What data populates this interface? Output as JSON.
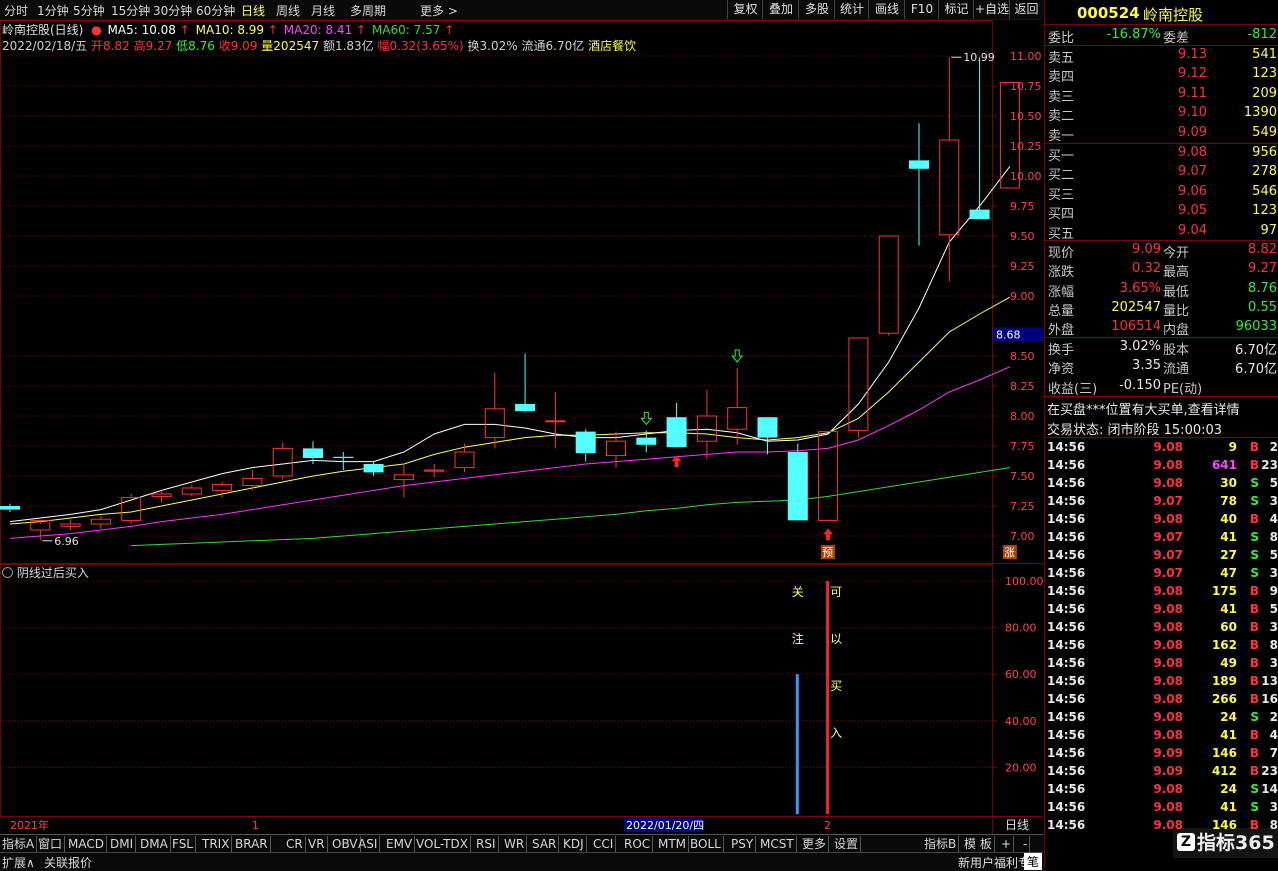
{
  "toolbar": {
    "periods": [
      "分时",
      "1分钟",
      "5分钟",
      "15分钟",
      "30分钟",
      "60分钟",
      "日线",
      "周线",
      "月线",
      "多周期",
      "更多 >"
    ],
    "active": "日线",
    "right_buttons": [
      "复权",
      "叠加",
      "多股",
      "统计",
      "画线",
      "F10",
      "标记",
      "+自选",
      "返回"
    ]
  },
  "chart_header": {
    "title": "岭南控股(日线)",
    "ma5": "MA5: 10.08",
    "ma10": "MA10: 8.99",
    "ma20": "MA20: 8.41",
    "ma60": "MA60: 7.57",
    "info_date": "2022/02/18/五",
    "open": "开8.82",
    "high": "高9.27",
    "low": "低8.76",
    "close": "收9.09",
    "volume": "量202547",
    "amount": "额1.83亿",
    "change": "幅0.32(3.65%)",
    "turnover": "换3.02%",
    "float_cap": "流通6.70亿",
    "industry": "酒店餐饮"
  },
  "colors": {
    "up": "#ff3333",
    "down": "#54ffff",
    "ma5": "#ffffff",
    "ma10": "#ffff55",
    "ma20": "#ff33ff",
    "ma60": "#33dd33",
    "grid": "#7a0000"
  },
  "chart_data": {
    "type": "candlestick",
    "y_ticks": [
      "11.00",
      "10.75",
      "10.50",
      "10.25",
      "10.00",
      "9.75",
      "9.50",
      "9.25",
      "9.00",
      "8.68",
      "8.50",
      "8.25",
      "8.00",
      "7.75",
      "7.50",
      "7.25",
      "7.00"
    ],
    "current_price_label": "8.68",
    "high_label": "10.99",
    "low_label": "6.96",
    "ylim": [
      6.88,
      11.18
    ],
    "candles": [
      [
        7.25,
        7.27,
        7.2,
        7.22
      ],
      [
        7.05,
        7.1,
        6.96,
        7.13
      ],
      [
        7.08,
        7.14,
        7.05,
        7.1
      ],
      [
        7.1,
        7.17,
        7.06,
        7.14
      ],
      [
        7.13,
        7.35,
        7.1,
        7.32
      ],
      [
        7.33,
        7.38,
        7.28,
        7.35
      ],
      [
        7.35,
        7.43,
        7.33,
        7.4
      ],
      [
        7.38,
        7.45,
        7.32,
        7.43
      ],
      [
        7.42,
        7.55,
        7.38,
        7.48
      ],
      [
        7.5,
        7.78,
        7.47,
        7.73
      ],
      [
        7.73,
        7.79,
        7.6,
        7.65
      ],
      [
        7.66,
        7.7,
        7.55,
        7.65
      ],
      [
        7.6,
        7.62,
        7.5,
        7.53
      ],
      [
        7.47,
        7.6,
        7.32,
        7.51
      ],
      [
        7.54,
        7.6,
        7.49,
        7.55
      ],
      [
        7.57,
        7.77,
        7.53,
        7.7
      ],
      [
        7.82,
        8.36,
        7.73,
        8.06
      ],
      [
        8.1,
        8.52,
        8.03,
        8.04
      ],
      [
        7.96,
        8.2,
        7.73,
        7.96
      ],
      [
        7.87,
        7.89,
        7.62,
        7.69
      ],
      [
        7.67,
        7.87,
        7.57,
        7.79
      ],
      [
        7.82,
        7.88,
        7.7,
        7.76
      ],
      [
        7.99,
        8.11,
        7.74,
        7.74
      ],
      [
        7.79,
        8.22,
        7.64,
        8.0
      ],
      [
        7.89,
        8.4,
        7.76,
        8.07
      ],
      [
        7.99,
        7.99,
        7.68,
        7.82
      ],
      [
        7.7,
        7.77,
        7.13,
        7.13
      ],
      [
        7.13,
        7.87,
        7.13,
        7.87
      ],
      [
        7.88,
        8.65,
        7.82,
        8.65
      ],
      [
        8.69,
        9.5,
        8.67,
        9.5
      ],
      [
        10.13,
        10.44,
        9.42,
        10.06
      ],
      [
        9.51,
        10.99,
        9.12,
        10.3
      ],
      [
        9.72,
        10.99,
        9.7,
        9.64
      ],
      [
        9.9,
        10.78,
        9.9,
        10.78
      ]
    ],
    "ma5": [
      7.12,
      7.15,
      7.18,
      7.22,
      7.3,
      7.38,
      7.45,
      7.52,
      7.57,
      7.6,
      7.63,
      7.62,
      7.62,
      7.7,
      7.85,
      7.93,
      7.93,
      7.9,
      7.85,
      7.82,
      7.82,
      7.85,
      7.88,
      7.89,
      7.86,
      7.79,
      7.8,
      7.85,
      8.1,
      8.45,
      8.9,
      9.45,
      9.75,
      10.08
    ],
    "ma10": [
      7.1,
      7.12,
      7.15,
      7.18,
      7.2,
      7.25,
      7.3,
      7.35,
      7.4,
      7.45,
      7.5,
      7.54,
      7.57,
      7.6,
      7.68,
      7.74,
      7.78,
      7.82,
      7.84,
      7.84,
      7.85,
      7.86,
      7.86,
      7.85,
      7.82,
      7.8,
      7.82,
      7.86,
      7.98,
      8.2,
      8.45,
      8.7,
      8.85,
      8.99
    ],
    "ma20": [
      6.98,
      7.0,
      7.02,
      7.05,
      7.08,
      7.12,
      7.15,
      7.18,
      7.22,
      7.26,
      7.3,
      7.34,
      7.38,
      7.42,
      7.45,
      7.48,
      7.51,
      7.54,
      7.57,
      7.6,
      7.62,
      7.64,
      7.66,
      7.68,
      7.7,
      7.7,
      7.71,
      7.73,
      7.8,
      7.92,
      8.05,
      8.2,
      8.3,
      8.41
    ],
    "ma60": [
      6.88,
      6.89,
      6.9,
      6.91,
      6.92,
      6.93,
      6.94,
      6.95,
      6.96,
      6.97,
      6.98,
      7.0,
      7.02,
      7.04,
      7.06,
      7.08,
      7.1,
      7.12,
      7.14,
      7.16,
      7.18,
      7.21,
      7.23,
      7.26,
      7.28,
      7.29,
      7.3,
      7.33,
      7.37,
      7.41,
      7.45,
      7.49,
      7.53,
      7.57
    ],
    "red_up_arrows_at": [
      22,
      27
    ],
    "green_down_arrows_at": [
      21,
      24
    ],
    "labels_at": [
      {
        "i": 27,
        "text": "预"
      },
      {
        "i": 33,
        "text": "涨"
      }
    ]
  },
  "indicator": {
    "title": "阴线过后买入",
    "y_ticks": [
      "100.00",
      "80.00",
      "60.00",
      "40.00",
      "20.00"
    ],
    "ylim": [
      0,
      105
    ],
    "cyan_bar": {
      "i": 26,
      "value": 60,
      "label_chars": [
        "关",
        "注"
      ]
    },
    "red_bar": {
      "i": 27,
      "value": 100,
      "label_chars": [
        "可",
        "以",
        "买",
        "入"
      ]
    }
  },
  "x_axis": {
    "labels": [
      "2021年",
      "1",
      "2022/01/20/四",
      "2"
    ],
    "period_label": "日线"
  },
  "bottom_tabs": [
    "指标A",
    "窗口",
    "MACD",
    "DMI",
    "DMA",
    "FSL",
    "TRIX",
    "BRAR",
    "CR",
    "VR",
    "OBV",
    "ASI",
    "EMV",
    "VOL-TDX",
    "RSI",
    "WR",
    "SAR",
    "KDJ",
    "CCI",
    "ROC",
    "MTM",
    "BOLL",
    "PSY",
    "MCST",
    "更多",
    "设置"
  ],
  "bottom_right_tabs": [
    "指标B",
    "模 板",
    "+",
    "-"
  ],
  "bottom_bar": {
    "left": [
      "扩展∧",
      "关联报价"
    ],
    "right": "新用户福利专享",
    "input": "笔"
  },
  "quote": {
    "code": "000524",
    "name": "岭南控股",
    "weibi_label": "委比",
    "weibi": "-16.87%",
    "weicha_label": "委差",
    "weicha": "-812",
    "sells": [
      {
        "label": "卖五",
        "price": "9.13",
        "vol": "541"
      },
      {
        "label": "卖四",
        "price": "9.12",
        "vol": "123"
      },
      {
        "label": "卖三",
        "price": "9.11",
        "vol": "209"
      },
      {
        "label": "卖二",
        "price": "9.10",
        "vol": "1390"
      },
      {
        "label": "卖一",
        "price": "9.09",
        "vol": "549"
      }
    ],
    "buys": [
      {
        "label": "买一",
        "price": "9.08",
        "vol": "956"
      },
      {
        "label": "买二",
        "price": "9.07",
        "vol": "278"
      },
      {
        "label": "买三",
        "price": "9.06",
        "vol": "546"
      },
      {
        "label": "买四",
        "price": "9.05",
        "vol": "123"
      },
      {
        "label": "买五",
        "price": "9.04",
        "vol": "97"
      }
    ],
    "stats": [
      {
        "l1": "现价",
        "v1": "9.09",
        "c1": "red",
        "l2": "今开",
        "v2": "8.82",
        "c2": "red"
      },
      {
        "l1": "涨跌",
        "v1": "0.32",
        "c1": "red",
        "l2": "最高",
        "v2": "9.27",
        "c2": "red"
      },
      {
        "l1": "涨幅",
        "v1": "3.65%",
        "c1": "red",
        "l2": "最低",
        "v2": "8.76",
        "c2": "green"
      },
      {
        "l1": "总量",
        "v1": "202547",
        "c1": "yellow",
        "l2": "量比",
        "v2": "0.55",
        "c2": "green"
      },
      {
        "l1": "外盘",
        "v1": "106514",
        "c1": "red",
        "l2": "内盘",
        "v2": "96033",
        "c2": "green"
      }
    ],
    "stats2": [
      {
        "l1": "换手",
        "v1": "3.02%",
        "l2": "股本",
        "v2": "6.70亿"
      },
      {
        "l1": "净资",
        "v1": "3.35",
        "l2": "流通",
        "v2": "6.70亿"
      },
      {
        "l1": "收益(三)",
        "v1": "-0.150",
        "l2": "PE(动)",
        "v2": ""
      }
    ],
    "notice": "在买盘***位置有大买单,查看详情",
    "status": "交易状态: 闭市阶段 15:00:03",
    "ticks": [
      {
        "t": "14:56",
        "p": "9.08",
        "v": "9",
        "s": "B",
        "n": "2"
      },
      {
        "t": "14:56",
        "p": "9.08",
        "v": "641",
        "s": "B",
        "n": "23"
      },
      {
        "t": "14:56",
        "p": "9.08",
        "v": "30",
        "s": "S",
        "n": "5"
      },
      {
        "t": "14:56",
        "p": "9.07",
        "v": "78",
        "s": "S",
        "n": "3"
      },
      {
        "t": "14:56",
        "p": "9.08",
        "v": "40",
        "s": "B",
        "n": "4"
      },
      {
        "t": "14:56",
        "p": "9.07",
        "v": "41",
        "s": "S",
        "n": "8"
      },
      {
        "t": "14:56",
        "p": "9.07",
        "v": "27",
        "s": "S",
        "n": "5"
      },
      {
        "t": "14:56",
        "p": "9.07",
        "v": "47",
        "s": "S",
        "n": "3"
      },
      {
        "t": "14:56",
        "p": "9.08",
        "v": "175",
        "s": "B",
        "n": "9"
      },
      {
        "t": "14:56",
        "p": "9.08",
        "v": "41",
        "s": "B",
        "n": "5"
      },
      {
        "t": "14:56",
        "p": "9.08",
        "v": "60",
        "s": "B",
        "n": "3"
      },
      {
        "t": "14:56",
        "p": "9.08",
        "v": "162",
        "s": "B",
        "n": "8"
      },
      {
        "t": "14:56",
        "p": "9.08",
        "v": "49",
        "s": "B",
        "n": "3"
      },
      {
        "t": "14:56",
        "p": "9.08",
        "v": "189",
        "s": "B",
        "n": "13"
      },
      {
        "t": "14:56",
        "p": "9.08",
        "v": "266",
        "s": "B",
        "n": "16"
      },
      {
        "t": "14:56",
        "p": "9.08",
        "v": "24",
        "s": "S",
        "n": "2"
      },
      {
        "t": "14:56",
        "p": "9.08",
        "v": "41",
        "s": "B",
        "n": "4"
      },
      {
        "t": "14:56",
        "p": "9.09",
        "v": "146",
        "s": "B",
        "n": "7"
      },
      {
        "t": "14:56",
        "p": "9.09",
        "v": "412",
        "s": "B",
        "n": "23"
      },
      {
        "t": "14:56",
        "p": "9.08",
        "v": "24",
        "s": "S",
        "n": "14"
      },
      {
        "t": "14:56",
        "p": "9.08",
        "v": "41",
        "s": "S",
        "n": "3"
      },
      {
        "t": "14:56",
        "p": "9.08",
        "v": "146",
        "s": "B",
        "n": "8"
      }
    ],
    "watermark": "指标365"
  }
}
